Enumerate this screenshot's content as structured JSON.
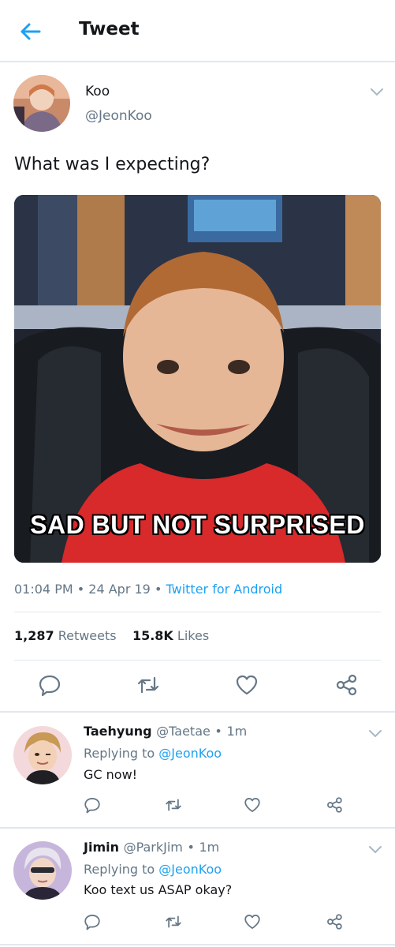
{
  "header": {
    "title": "Tweet",
    "back_icon": "arrow-left-icon"
  },
  "tweet": {
    "author_name": "Koo",
    "author_handle": "@JeonKoo",
    "text": "What was I expecting?",
    "image_caption": "SAD BUT NOT SURPRISED",
    "time": "01:04 PM",
    "date": "24 Apr 19",
    "source": "Twitter for Android",
    "retweets_count": "1,287",
    "retweets_label": "Retweets",
    "likes_count": "15.8K",
    "likes_label": "Likes"
  },
  "actions": {
    "reply_icon": "reply-icon",
    "retweet_icon": "retweet-icon",
    "like_icon": "heart-icon",
    "share_icon": "share-icon"
  },
  "replies": [
    {
      "name": "Taehyung",
      "handle": "@Taetae",
      "time": "1m",
      "replying_prefix": "Replying to",
      "replying_to": "@JeonKoo",
      "text": "GC now!"
    },
    {
      "name": "Jimin",
      "handle": "@ParkJim",
      "time": "1m",
      "replying_prefix": "Replying to",
      "replying_to": "@JeonKoo",
      "text": "Koo text us ASAP okay?"
    }
  ],
  "colors": {
    "accent": "#1da1f2",
    "secondary_text": "#657786",
    "divider": "#e1e8ed"
  }
}
